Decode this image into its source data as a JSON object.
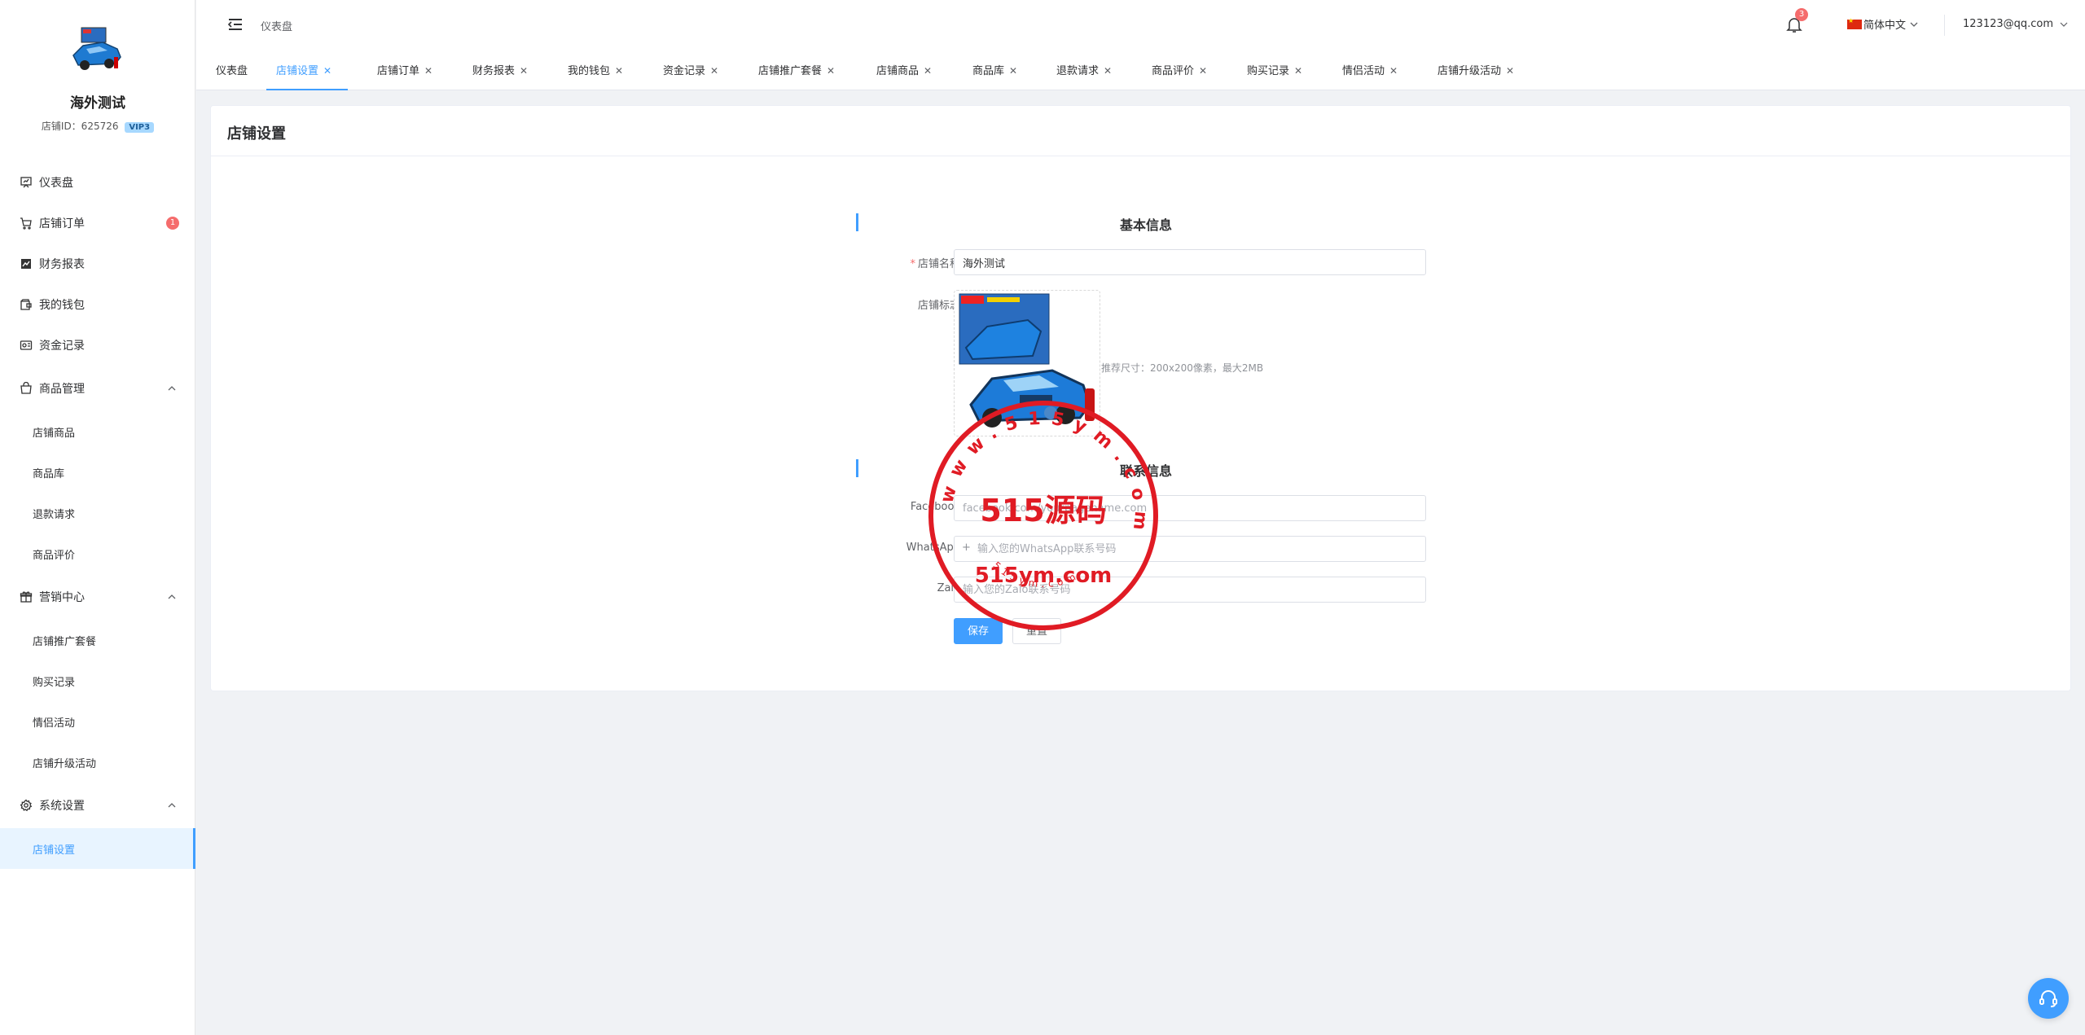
{
  "shop": {
    "name": "海外测试",
    "id_label": "店铺ID：625726",
    "vip": "VIP3"
  },
  "sidebar": {
    "items": [
      {
        "label": "仪表盘",
        "icon": "dashboard-icon"
      },
      {
        "label": "店铺订单",
        "icon": "cart-icon",
        "badge": "1"
      },
      {
        "label": "财务报表",
        "icon": "chart-icon"
      },
      {
        "label": "我的钱包",
        "icon": "wallet-icon"
      },
      {
        "label": "资金记录",
        "icon": "record-icon"
      },
      {
        "label": "商品管理",
        "icon": "bag-icon"
      },
      {
        "label": "店铺商品"
      },
      {
        "label": "商品库"
      },
      {
        "label": "退款请求"
      },
      {
        "label": "商品评价"
      },
      {
        "label": "营销中心",
        "icon": "gift-icon"
      },
      {
        "label": "店铺推广套餐"
      },
      {
        "label": "购买记录"
      },
      {
        "label": "情侣活动"
      },
      {
        "label": "店铺升级活动"
      },
      {
        "label": "系统设置",
        "icon": "gear-icon"
      },
      {
        "label": "店铺设置"
      }
    ]
  },
  "header": {
    "breadcrumb": "仪表盘",
    "notification_count": "3",
    "language": "简体中文",
    "user_email": "123123@qq.com"
  },
  "tabs": [
    "仪表盘",
    "店铺设置",
    "店铺订单",
    "财务报表",
    "我的钱包",
    "资金记录",
    "店铺推广套餐",
    "店铺商品",
    "商品库",
    "退款请求",
    "商品评价",
    "购买记录",
    "情侣活动",
    "店铺升级活动"
  ],
  "page": {
    "title": "店铺设置",
    "basic_section": "基本信息",
    "shop_name_label": "店铺名称",
    "shop_name_value": "海外测试",
    "logo_label": "店铺标志",
    "logo_hint": "推荐尺寸：200x200像素，最大2MB",
    "contact_section": "联系信息",
    "facebook_label": "Facebook",
    "facebook_placeholder": "facebook.com/yourpagename.com",
    "whatsapp_label": "WhatsApp",
    "whatsapp_prefix": "+",
    "whatsapp_placeholder": "输入您的WhatsApp联系号码",
    "zalo_label": "Zalo",
    "zalo_placeholder": "输入您的Zalo联系号码",
    "save_label": "保存",
    "reset_label": "重置"
  },
  "watermark": {
    "big_text": "515源码",
    "mid_text": "515ym.com",
    "ring_text": "www.515ym.com",
    "color": "#e01b24"
  },
  "colors": {
    "accent": "#409eff",
    "badge": "#f56c6c"
  }
}
